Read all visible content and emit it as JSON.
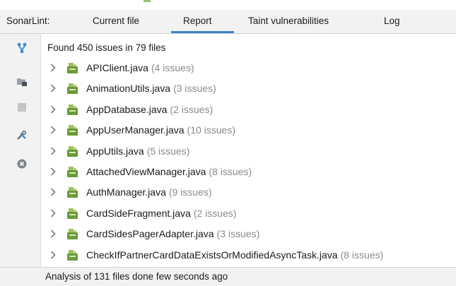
{
  "toolwindow": {
    "label": "SonarLint:",
    "tabs": [
      {
        "label": "Current file",
        "active": false
      },
      {
        "label": "Report",
        "active": true
      },
      {
        "label": "Taint vulnerabilities",
        "active": false
      },
      {
        "label": "Log",
        "active": false
      }
    ],
    "accent_color": "#4083c9"
  },
  "sidebar": {
    "icons": [
      "branch-icon",
      "folder-icon",
      "stop-icon",
      "tools-icon",
      "clear-icon"
    ]
  },
  "report": {
    "summary": "Found 450 issues in 79 files",
    "files": [
      {
        "name": "APIClient.java",
        "issues": "(4 issues)"
      },
      {
        "name": "AnimationUtils.java",
        "issues": "(3 issues)"
      },
      {
        "name": "AppDatabase.java",
        "issues": "(2 issues)"
      },
      {
        "name": "AppUserManager.java",
        "issues": "(10 issues)"
      },
      {
        "name": "AppUtils.java",
        "issues": "(5 issues)"
      },
      {
        "name": "AttachedViewManager.java",
        "issues": "(8 issues)"
      },
      {
        "name": "AuthManager.java",
        "issues": "(9 issues)"
      },
      {
        "name": "CardSideFragment.java",
        "issues": "(2 issues)"
      },
      {
        "name": "CardSidesPagerAdapter.java",
        "issues": "(3 issues)"
      },
      {
        "name": "CheckIfPartnerCardDataExistsOrModifiedAsyncTask.java",
        "issues": "(8 issues)"
      }
    ]
  },
  "status": {
    "text": "Analysis of 131 files done few seconds ago"
  }
}
